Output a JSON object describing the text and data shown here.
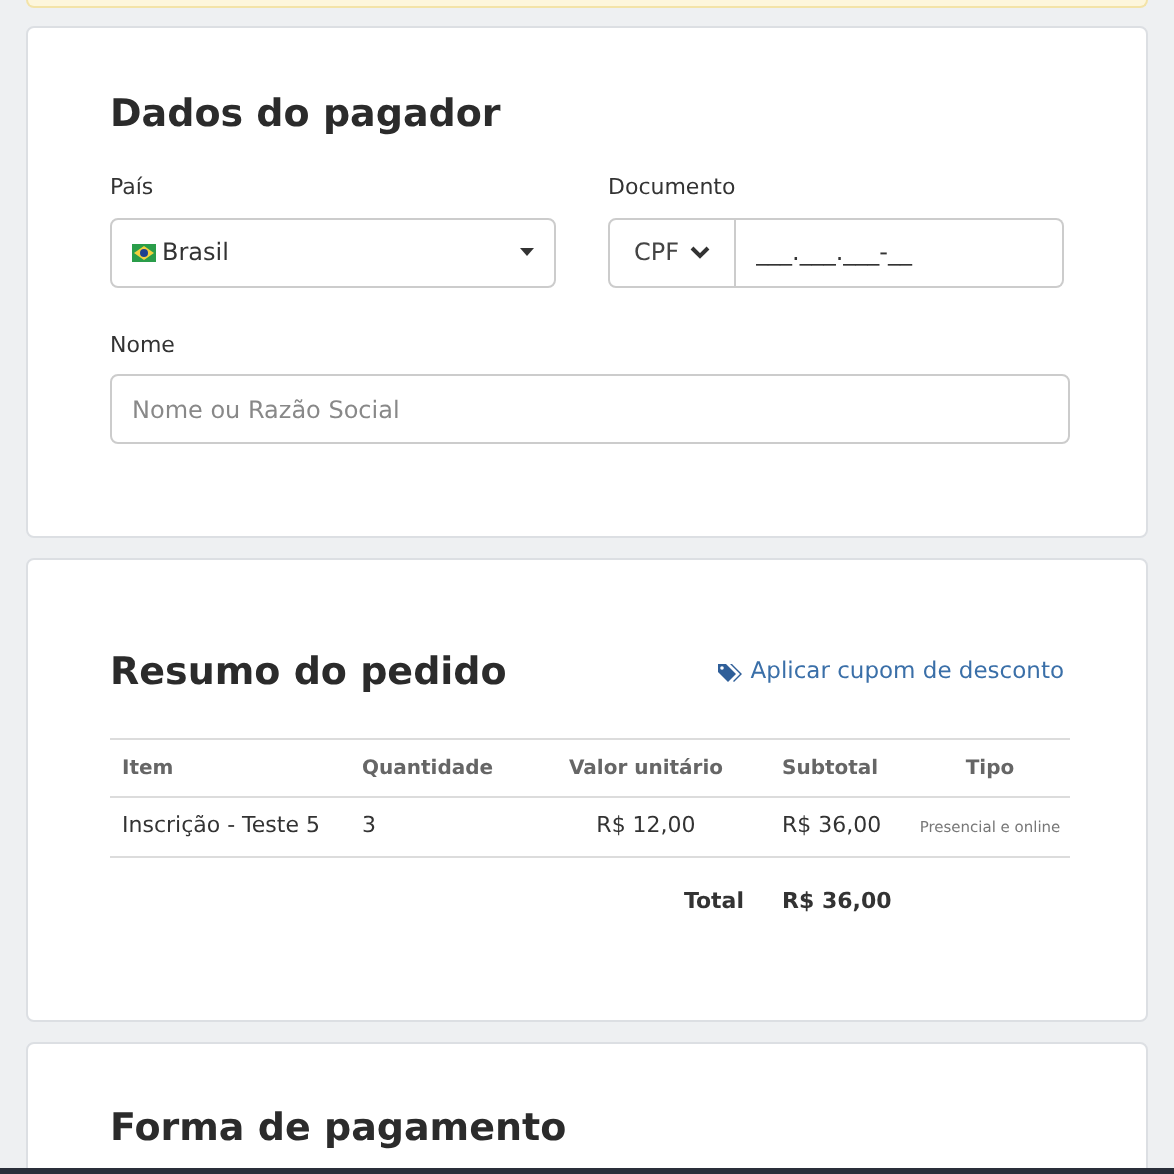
{
  "payer": {
    "title": "Dados do pagador",
    "country": {
      "label": "País",
      "value": "Brasil"
    },
    "document": {
      "label": "Documento",
      "type": "CPF",
      "value": "___.___.___-__"
    },
    "name": {
      "label": "Nome",
      "placeholder": "Nome ou Razão Social"
    }
  },
  "order": {
    "title": "Resumo do pedido",
    "coupon_link": "Aplicar cupom de desconto",
    "columns": [
      "Item",
      "Quantidade",
      "Valor unitário",
      "Subtotal",
      "Tipo"
    ],
    "rows": [
      {
        "item": "Inscrição - Teste 5",
        "quantity": "3",
        "unit_price": "R$ 12,00",
        "subtotal": "R$ 36,00",
        "type": "Presencial e online"
      }
    ],
    "total_label": "Total",
    "total": "R$ 36,00"
  },
  "payment": {
    "title": "Forma de pagamento"
  }
}
